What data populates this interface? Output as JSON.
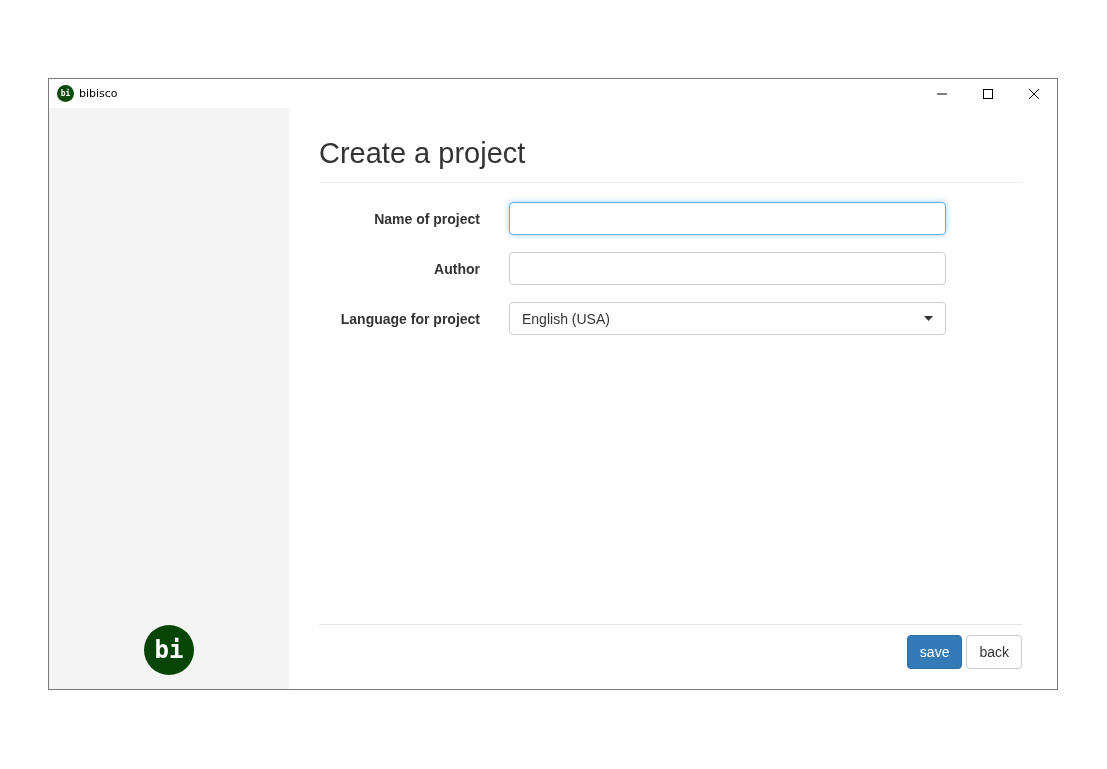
{
  "window": {
    "title": "bibisco",
    "logo_text": "bi"
  },
  "sidebar": {
    "logo_text": "bi"
  },
  "heading": "Create a project",
  "form": [
    {
      "kind": "text",
      "label": "Name of project",
      "focused": true
    },
    {
      "kind": "text",
      "label": "Author",
      "focused": false
    },
    {
      "kind": "select",
      "label": "Language for project",
      "value": "English (USA)",
      "focused": false
    }
  ],
  "buttons": [
    {
      "label": "save",
      "primary": true
    },
    {
      "label": "back",
      "primary": false
    }
  ]
}
